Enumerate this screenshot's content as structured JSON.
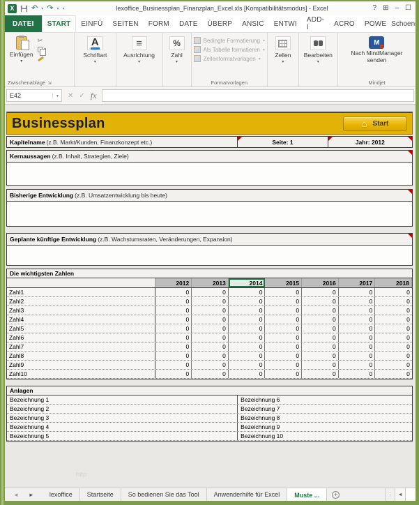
{
  "window": {
    "title": "lexoffice_Businessplan_Finanzplan_Excel.xls  [Kompatibilitätsmodus] - Excel",
    "controls": {
      "help": "?",
      "ribbon_options": "⊞",
      "minimize": "–",
      "maximize": "☐"
    }
  },
  "quick_access": {
    "excel_logo": "X",
    "undo": "↶",
    "redo": "↷"
  },
  "ribbon_tabs": {
    "file": "DATEI",
    "active": "START",
    "others": [
      "EINFÜ",
      "SEITEN",
      "FORM",
      "DATE",
      "ÜBERP",
      "ANSIC",
      "ENTWI",
      "ADD-I",
      "ACRO",
      "POWE"
    ],
    "account": "Schoenstei..."
  },
  "ribbon": {
    "paste": "Einfügen",
    "font": "Schriftart",
    "alignment": "Ausrichtung",
    "number": "Zahl",
    "styles_buttons": [
      "Bedingte Formatierung",
      "Als Tabelle formatieren",
      "Zellenformatvorlagen"
    ],
    "cells": "Zellen",
    "editing": "Bearbeiten",
    "mindmanager_line1": "Nach MindManager",
    "mindmanager_line2": "senden",
    "group_clipboard": "Zwischenablage",
    "group_styles": "Formatvorlagen",
    "group_mindjet": "Mindjet"
  },
  "formula_bar": {
    "name_box": "E42",
    "cancel": "✕",
    "enter": "✓",
    "fx": "fx"
  },
  "sheet": {
    "banner": {
      "title": "Businessplan",
      "start_button": "Start"
    },
    "chapter_row": {
      "name_bold": "Kapitelname",
      "name_rest": "(z.B. Markt/Kunden, Finanzkonzept etc.)",
      "page": "Seite: 1",
      "year": "Jahr: 2012"
    },
    "sections": {
      "kern_bold": "Kernaussagen",
      "kern_rest": "(z.B. Inhalt, Strategien, Ziele)",
      "bisher_bold": "Bisherige Entwicklung",
      "bisher_rest": "(z.B. Umsatzentwicklung bis heute)",
      "geplant_bold": "Geplante künftige Entwicklung",
      "geplant_rest": "(z.B. Wachstumsraten, Veränderungen, Expansion)"
    },
    "numbers_table": {
      "title": "Die wichtigsten Zahlen",
      "years": [
        "2012",
        "2013",
        "2014",
        "2015",
        "2016",
        "2017",
        "2018"
      ],
      "selected_year": "2014",
      "rows": [
        {
          "label": "Zahl1",
          "values": [
            "0",
            "0",
            "0",
            "0",
            "0",
            "0",
            "0"
          ]
        },
        {
          "label": "Zahl2",
          "values": [
            "0",
            "0",
            "0",
            "0",
            "0",
            "0",
            "0"
          ]
        },
        {
          "label": "Zahl3",
          "values": [
            "0",
            "0",
            "0",
            "0",
            "0",
            "0",
            "0"
          ]
        },
        {
          "label": "Zahl4",
          "values": [
            "0",
            "0",
            "0",
            "0",
            "0",
            "0",
            "0"
          ]
        },
        {
          "label": "Zahl5",
          "values": [
            "0",
            "0",
            "0",
            "0",
            "0",
            "0",
            "0"
          ]
        },
        {
          "label": "Zahl6",
          "values": [
            "0",
            "0",
            "0",
            "0",
            "0",
            "0",
            "0"
          ]
        },
        {
          "label": "Zahl7",
          "values": [
            "0",
            "0",
            "0",
            "0",
            "0",
            "0",
            "0"
          ]
        },
        {
          "label": "Zahl8",
          "values": [
            "0",
            "0",
            "0",
            "0",
            "0",
            "0",
            "0"
          ]
        },
        {
          "label": "Zahl9",
          "values": [
            "0",
            "0",
            "0",
            "0",
            "0",
            "0",
            "0"
          ]
        },
        {
          "label": "Zahl10",
          "values": [
            "0",
            "0",
            "0",
            "0",
            "0",
            "0",
            "0"
          ]
        }
      ]
    },
    "anlagen": {
      "title": "Anlagen",
      "rows": [
        {
          "left": "Bezeichnung 1",
          "right": "Bezeichnung 6"
        },
        {
          "left": "Bezeichnung 2",
          "right": "Bezeichnung 7"
        },
        {
          "left": "Bezeichnung 3",
          "right": "Bezeichnung 8"
        },
        {
          "left": "Bezeichnung 4",
          "right": "Bezeichnung 9"
        },
        {
          "left": "Bezeichnung 5",
          "right": "Bezeichnung 10"
        }
      ]
    },
    "faint_text": "http"
  },
  "sheet_tabs": {
    "nav_left": "◄",
    "nav_right": "►",
    "tabs": [
      "lexoffice",
      "Startseite",
      "So bedienen Sie das Tool",
      "Anwenderhilfe für Excel"
    ],
    "active_tab": "Muste ...",
    "add_sheet": "+",
    "scroll_left": "◄"
  }
}
